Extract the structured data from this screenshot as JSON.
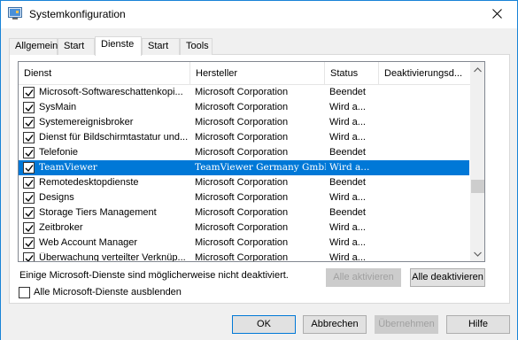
{
  "window": {
    "title": "Systemkonfiguration"
  },
  "tabs": [
    {
      "label": "Allgemein",
      "active": false
    },
    {
      "label": "Start",
      "active": false
    },
    {
      "label": "Dienste",
      "active": true
    },
    {
      "label": "Start",
      "active": false
    },
    {
      "label": "Tools",
      "active": false
    }
  ],
  "list": {
    "headers": [
      "Dienst",
      "Hersteller",
      "Status",
      "Deaktivierungsd..."
    ],
    "rows": [
      {
        "checked": true,
        "name": "Microsoft-Softwareschattenkopi...",
        "vendor": "Microsoft Corporation",
        "status": "Beendet",
        "selected": false
      },
      {
        "checked": true,
        "name": "SysMain",
        "vendor": "Microsoft Corporation",
        "status": "Wird a...",
        "selected": false
      },
      {
        "checked": true,
        "name": "Systemereignisbroker",
        "vendor": "Microsoft Corporation",
        "status": "Wird a...",
        "selected": false
      },
      {
        "checked": true,
        "name": "Dienst für Bildschirmtastatur und...",
        "vendor": "Microsoft Corporation",
        "status": "Wird a...",
        "selected": false
      },
      {
        "checked": true,
        "name": "Telefonie",
        "vendor": "Microsoft Corporation",
        "status": "Beendet",
        "selected": false
      },
      {
        "checked": true,
        "name": "TeamViewer",
        "vendor": "TeamViewer Germany GmbH",
        "status": "Wird a...",
        "selected": true
      },
      {
        "checked": true,
        "name": "Remotedesktopdienste",
        "vendor": "Microsoft Corporation",
        "status": "Beendet",
        "selected": false
      },
      {
        "checked": true,
        "name": "Designs",
        "vendor": "Microsoft Corporation",
        "status": "Wird a...",
        "selected": false
      },
      {
        "checked": true,
        "name": "Storage Tiers Management",
        "vendor": "Microsoft Corporation",
        "status": "Beendet",
        "selected": false
      },
      {
        "checked": true,
        "name": "Zeitbroker",
        "vendor": "Microsoft Corporation",
        "status": "Wird a...",
        "selected": false
      },
      {
        "checked": true,
        "name": "Web Account Manager",
        "vendor": "Microsoft Corporation",
        "status": "Wird a...",
        "selected": false
      },
      {
        "checked": true,
        "name": "Überwachung verteilter Verknüp...",
        "vendor": "Microsoft Corporation",
        "status": "Wird a...",
        "selected": false
      }
    ]
  },
  "note": "Einige Microsoft-Dienste sind möglicherweise nicht deaktiviert.",
  "buttons": {
    "enable_all": "Alle aktivieren",
    "disable_all": "Alle deaktivieren",
    "ok": "OK",
    "cancel": "Abbrechen",
    "apply": "Übernehmen",
    "help": "Hilfe"
  },
  "hide_ms": {
    "label": "Alle Microsoft-Dienste ausblenden",
    "checked": false
  },
  "colors": {
    "selection": "#0078d7",
    "accent": "#1883d7"
  }
}
